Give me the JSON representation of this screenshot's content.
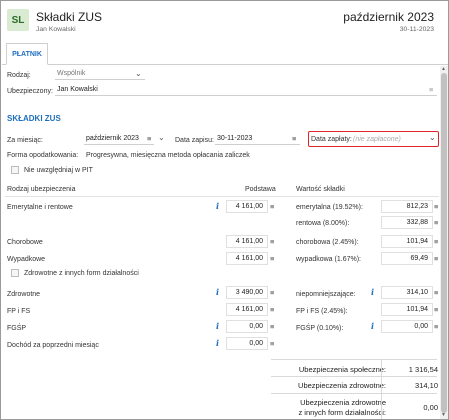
{
  "header": {
    "logo": "SL",
    "title": "Składki ZUS",
    "user": "Jan  Kowalski",
    "period": "październik 2023",
    "date": "30-11-2023"
  },
  "tabs": [
    {
      "label": "PŁATNIK"
    }
  ],
  "payer": {
    "rodzaj_label": "Rodzaj:",
    "rodzaj_value": "Wspólnik",
    "ubezpieczony_label": "Ubezpieczony:",
    "ubezpieczony_value": "Jan  Kowalski"
  },
  "section": {
    "title": "SKŁADKI ZUS"
  },
  "month": {
    "label": "Za miesiąc:",
    "value": "październik 2023"
  },
  "record_date": {
    "label": "Data zapisu:",
    "value": "30-11-2023"
  },
  "payment_date": {
    "label": "Data zapłaty:",
    "placeholder": "(nie zapłacone)"
  },
  "taxation": {
    "label": "Forma opodatkowania:",
    "value": "Progresywna, miesięczna metoda opłacania zaliczek"
  },
  "pit_checkbox": {
    "label": "Nie uwzględniaj w PIT"
  },
  "columns": {
    "c1": "Rodzaj ubezpieczenia",
    "c2": "Podstawa",
    "c3": "Wartość składki"
  },
  "rows": {
    "emerytalne": {
      "label": "Emerytalne i rentowe",
      "base": "4 161,00"
    },
    "emerytalna_rate": {
      "label": "emerytalna (19.52%):",
      "value": "812,23"
    },
    "rentowa_rate": {
      "label": "rentowa (8.00%):",
      "value": "332,88"
    },
    "chorobowe": {
      "label": "Chorobowe",
      "base": "4 161,00",
      "rate_label": "chorobowa (2.45%):",
      "value": "101,94"
    },
    "wypadkowe": {
      "label": "Wypadkowe",
      "base": "4 161,00",
      "rate_label": "wypadkowa (1.67%):",
      "value": "69,49"
    },
    "zdrowotne_checkbox": {
      "label": "Zdrowotne z innych form działalności"
    },
    "zdrowotne": {
      "label": "Zdrowotne",
      "base": "3 490,00",
      "rate_label": "niepomniejszające:",
      "value": "314,10"
    },
    "fp": {
      "label": "FP i FS",
      "base": "4 161,00",
      "rate_label": "FP i FS (2.45%):",
      "value": "101,94"
    },
    "fgsp": {
      "label": "FGŚP",
      "base": "0,00",
      "rate_label": "FGŚP (0.10%):",
      "value": "0,00"
    },
    "dochod": {
      "label": "Dochód za poprzedni miesiąc",
      "base": "0,00"
    }
  },
  "summary": {
    "spoleczne_label": "Ubezpieczenia społeczne:",
    "spoleczne_value": "1 316,54",
    "zdrowotne_label": "Ubezpieczenia zdrowotne:",
    "zdrowotne_value": "314,10",
    "inne_label_1": "Ubezpieczenia zdrowotne",
    "inne_label_2": "z innych form działalności:",
    "inne_value": "0,00"
  },
  "colors": {
    "accent": "#1f6fbf",
    "highlight": "#e0242a"
  }
}
